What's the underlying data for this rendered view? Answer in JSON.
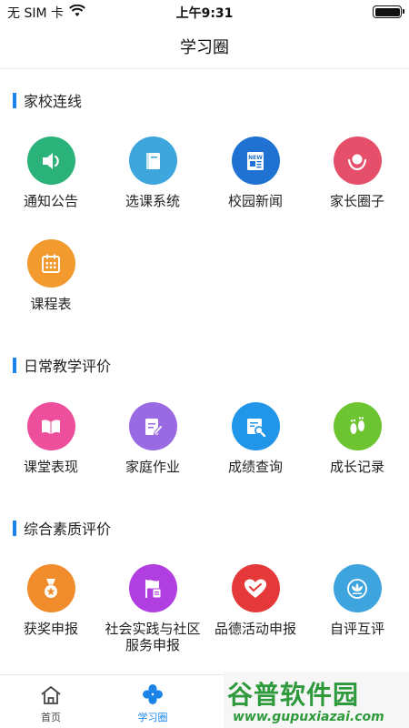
{
  "status_bar": {
    "carrier": "无 SIM 卡",
    "time": "上午9:31"
  },
  "nav": {
    "title": "学习圈"
  },
  "sections": [
    {
      "title": "家校连线",
      "items": [
        {
          "label": "通知公告",
          "icon": "speaker-icon",
          "color": "#2bb17a"
        },
        {
          "label": "选课系统",
          "icon": "book-icon",
          "color": "#3da6dd"
        },
        {
          "label": "校园新闻",
          "icon": "newspaper-icon",
          "color": "#1f72d2"
        },
        {
          "label": "家长圈子",
          "icon": "parent-icon",
          "color": "#e54f6a"
        },
        {
          "label": "课程表",
          "icon": "calendar-icon",
          "color": "#f29a2e"
        }
      ]
    },
    {
      "title": "日常教学评价",
      "items": [
        {
          "label": "课堂表现",
          "icon": "open-book-icon",
          "color": "#ee4f9c"
        },
        {
          "label": "家庭作业",
          "icon": "edit-icon",
          "color": "#9a6ae2"
        },
        {
          "label": "成绩查询",
          "icon": "search-report-icon",
          "color": "#2196e8"
        },
        {
          "label": "成长记录",
          "icon": "footprint-icon",
          "color": "#6dc431"
        }
      ]
    },
    {
      "title": "综合素质评价",
      "items": [
        {
          "label": "获奖申报",
          "icon": "medal-icon",
          "color": "#f08c2c"
        },
        {
          "label": "社会实践与社区\n服务申报",
          "icon": "flag-icon",
          "color": "#b13ee0"
        },
        {
          "label": "品德活动申报",
          "icon": "heart-icon",
          "color": "#e53939"
        },
        {
          "label": "自评互评",
          "icon": "lotus-icon",
          "color": "#3ea4dd"
        }
      ]
    }
  ],
  "tab_bar": {
    "home_label": "首页",
    "circle_label": "学习圈",
    "active_color": "#1a84e8"
  },
  "watermark": {
    "main": "谷普软件园",
    "sub": "www.gupuxiazai.com"
  }
}
